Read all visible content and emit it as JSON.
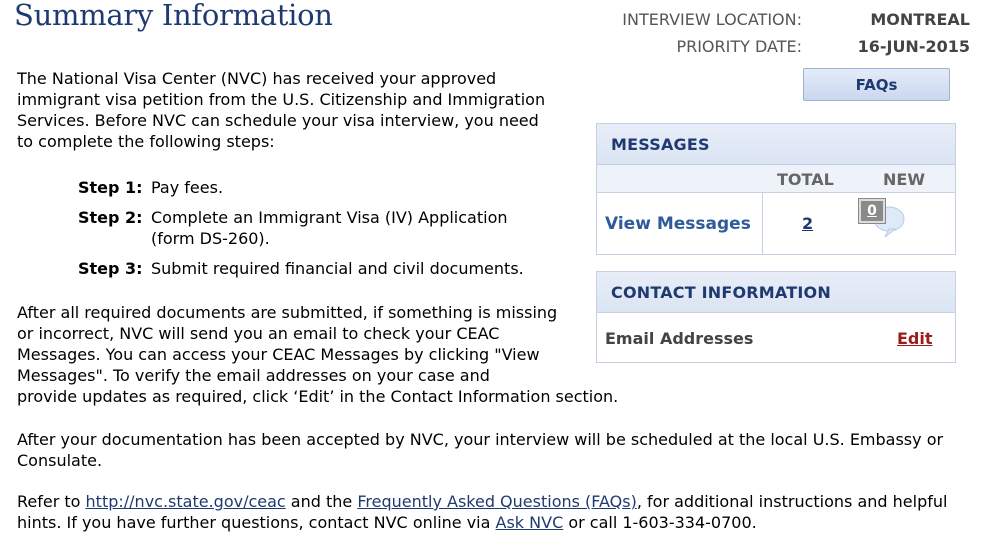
{
  "page": {
    "title": "Summary Information"
  },
  "meta": {
    "interview_location_label": "INTERVIEW LOCATION:",
    "interview_location_value": "MONTREAL",
    "priority_date_label": "PRIORITY DATE:",
    "priority_date_value": "16-JUN-2015"
  },
  "faqs_button": "FAQs",
  "intro": "The National Visa Center (NVC) has received your approved immigrant visa petition from the U.S. Citizenship and Immigration Services. Before NVC can schedule your visa interview, you need to complete the following steps:",
  "steps": [
    {
      "label": "Step 1:",
      "text": "Pay fees."
    },
    {
      "label": "Step 2:",
      "text": "Complete an Immigrant Visa (IV) Application (form DS-260)."
    },
    {
      "label": "Step 3:",
      "text": "Submit required financial and civil documents."
    }
  ],
  "para2_a": "After all required documents are submitted, if something is missing or incorrect, NVC will send you an email to check your CEAC Messages. You can access your CEAC Messages by clicking \"View Messages\". To verify the email addresses on your case and",
  "para2_b": "provide updates as required, click ‘Edit’ in the Contact Information section.",
  "para3": "After your documentation has been accepted by NVC, your interview will be scheduled at the local U.S. Embassy or Consulate.",
  "para4": {
    "prefix": "Refer to ",
    "link1": "http://nvc.state.gov/ceac",
    "mid1": " and the ",
    "link2": "Frequently Asked Questions (FAQs)",
    "mid2": ", for additional instructions and helpful hints. If you have further questions, contact NVC online via ",
    "link3": "Ask NVC",
    "suffix": " or call 1-603-334-0700."
  },
  "messages": {
    "heading": "MESSAGES",
    "col_total": "TOTAL",
    "col_new": "NEW",
    "view_label": "View Messages",
    "total": "2",
    "new": "0"
  },
  "contact": {
    "heading": "CONTACT INFORMATION",
    "email_label": "Email Addresses",
    "edit_label": "Edit"
  }
}
